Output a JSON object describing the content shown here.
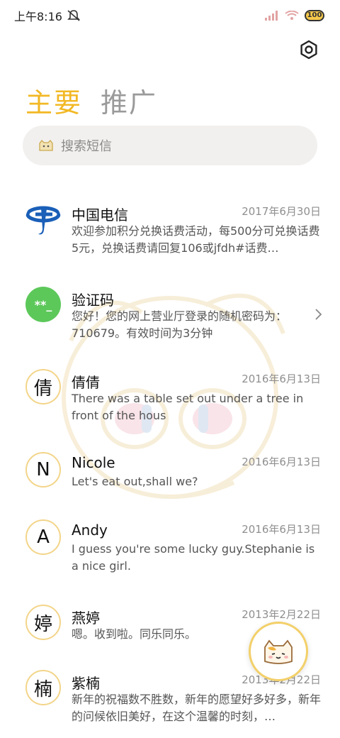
{
  "statusbar": {
    "time": "上午8:16",
    "battery": "100",
    "icons": [
      "mute-icon",
      "signal-icon",
      "wifi-icon",
      "battery-icon"
    ]
  },
  "tabs": [
    {
      "label": "主要",
      "active": true
    },
    {
      "label": "推广",
      "active": false
    }
  ],
  "search": {
    "placeholder": "搜索短信",
    "icon": "cat-icon"
  },
  "colors": {
    "accent": "#f2b824",
    "green_avatar": "#5cc85a",
    "ring": "#f3d58a"
  },
  "messages": [
    {
      "name": "中国电信",
      "date": "2017年6月30日",
      "preview": "欢迎参加积分兑换话费活动，每500分可兑换话费5元，兑换话费请回复106或jfdh#话费…",
      "avatar": "china-telecom-logo"
    },
    {
      "name": "验证码",
      "date": "",
      "preview": "您好！您的网上营业厅登录的随机密码为：710679。有效时间为3分钟",
      "avatar_text": "**_"
    },
    {
      "name": "倩倩",
      "date": "2016年6月13日",
      "preview": "There was a table set out under a tree in front of the hous",
      "avatar_text": "倩"
    },
    {
      "name": "Nicole",
      "date": "2016年6月13日",
      "preview": "Let's eat out,shall we?",
      "avatar_text": "N"
    },
    {
      "name": "Andy",
      "date": "2016年6月13日",
      "preview": "I guess you're some lucky guy.Stephanie is a nice girl.",
      "avatar_text": "A"
    },
    {
      "name": "燕婷",
      "date": "2013年2月22日",
      "preview": "嗯。收到啦。同乐同乐。",
      "avatar_text": "婷"
    },
    {
      "name": "紫楠",
      "date": "2013年2月22日",
      "preview": "新年的祝福数不胜数，新年的愿望好多好多，新年的问候依旧美好，在这个温馨的时刻，…",
      "avatar_text": "楠"
    }
  ]
}
